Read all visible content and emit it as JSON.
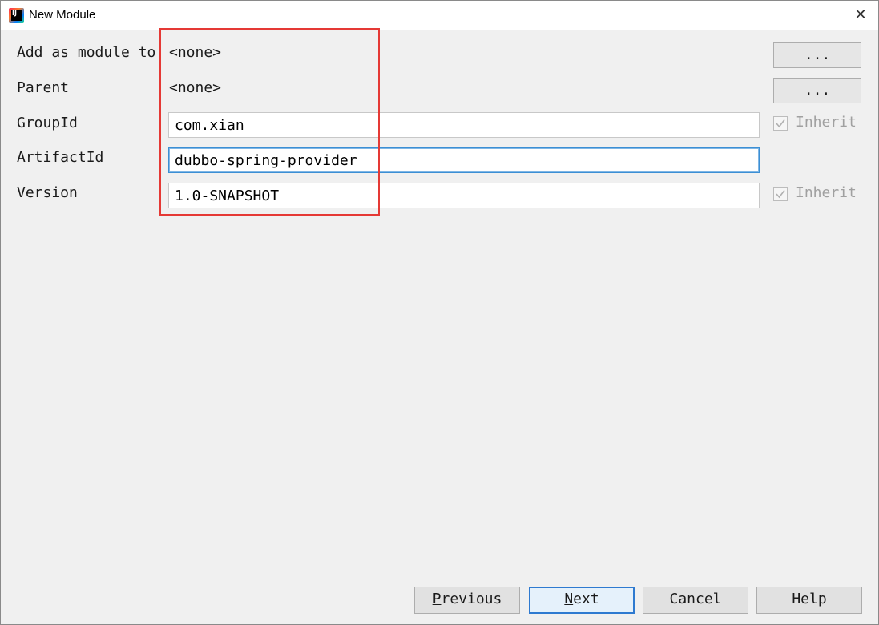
{
  "window": {
    "title": "New Module",
    "app_icon": "intellij-idea-icon",
    "close_icon": "close-icon"
  },
  "form": {
    "add_as_module": {
      "label": "Add as module to",
      "value": "<none>",
      "button_label": "..."
    },
    "parent": {
      "label": "Parent",
      "value": "<none>",
      "button_label": "..."
    },
    "group_id": {
      "label": "GroupId",
      "value": "com.xian",
      "inherit_label": "Inherit",
      "inherit_checked": true
    },
    "artifact_id": {
      "label": "ArtifactId",
      "value": "dubbo-spring-provider"
    },
    "version": {
      "label": "Version",
      "value": "1.0-SNAPSHOT",
      "inherit_label": "Inherit",
      "inherit_checked": true
    }
  },
  "buttons": {
    "previous": {
      "mnemonic": "P",
      "rest": "revious"
    },
    "next": {
      "mnemonic": "N",
      "rest": "ext"
    },
    "cancel": "Cancel",
    "help": "Help"
  },
  "colors": {
    "highlight": "#e53935",
    "focus": "#3c8fd4"
  }
}
